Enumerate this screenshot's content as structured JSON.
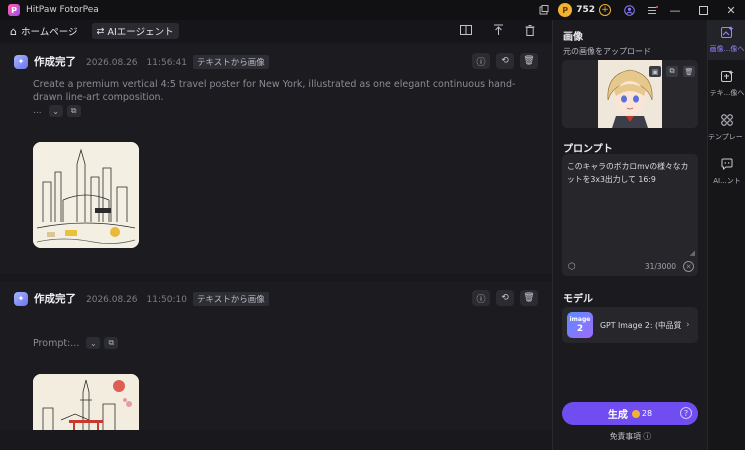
{
  "app": {
    "title": "HitPaw FotorPea",
    "logo_letter": "P"
  },
  "titlebar": {
    "credits": "752",
    "coin_symbol": "P",
    "plus": "+"
  },
  "toolbar": {
    "home_label": "ホームページ",
    "agent_label": "AIエージェント"
  },
  "cards": [
    {
      "status": "作成完了",
      "timestamp": "2026.08.26　11:56:41",
      "tag": "テキストから画像",
      "prompt": "Create a premium vertical 4:5 travel poster for New York, illustrated as one elegant continuous hand-drawn line-art composition.",
      "more": "..."
    },
    {
      "status": "作成完了",
      "timestamp": "2026.08.26　11:50:10",
      "tag": "テキストから画像",
      "prompt_label": "Prompt:..."
    }
  ],
  "panel": {
    "image_title": "画像",
    "upload_subtitle": "元の画像をアップロード",
    "prompt_title": "プロンプト",
    "prompt_value": "このキャラのボカロmvの様々なカットを3x3出力して 16:9",
    "char_count": "31/3000",
    "model_title": "モデル",
    "model_name": "GPT Image 2: (中品質)...",
    "model_icon_line1": "image",
    "model_icon_line2": "2",
    "generate_label": "生成",
    "generate_cost": "28",
    "disclaimer": "免責事項 ⓘ"
  },
  "rail": [
    {
      "label": "画像...像へ"
    },
    {
      "label": "テキ...像へ"
    },
    {
      "label": "テンプレート"
    },
    {
      "label": "AI...ント"
    }
  ],
  "colors": {
    "accent": "#6f4df0",
    "coin": "#f2b233",
    "bg": "#19191d"
  }
}
